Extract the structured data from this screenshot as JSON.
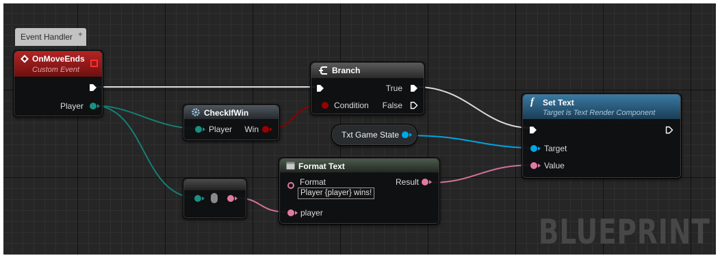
{
  "comment": {
    "text": "Event Handler",
    "icon": "pin-icon"
  },
  "nodes": {
    "on_move_ends": {
      "title": "OnMoveEnds",
      "subtitle": "Custom Event",
      "pin_player": "Player",
      "header_color": "#8e1b1b"
    },
    "branch": {
      "title": "Branch",
      "pin_condition": "Condition",
      "pin_true": "True",
      "pin_false": "False"
    },
    "check_if_win": {
      "title": "CheckIfWin",
      "pin_player": "Player",
      "pin_win": "Win"
    },
    "txt_game_state": {
      "label": "Txt Game State"
    },
    "set_text": {
      "title": "Set Text",
      "subtitle": "Target is Text Render Component",
      "pin_target": "Target",
      "pin_value": "Value",
      "header_color": "#2a5a79"
    },
    "format_text": {
      "title": "Format Text",
      "pin_format": "Format",
      "format_value": "Player {player} wins!",
      "pin_result": "Result",
      "pin_player": "player"
    }
  },
  "colors": {
    "exec": "#ffffff",
    "object": "#00a7ea",
    "teal": "#1a8f82",
    "bool": "#9c0000",
    "text": "#e07aa0"
  },
  "watermark": "BLUEPRINT"
}
